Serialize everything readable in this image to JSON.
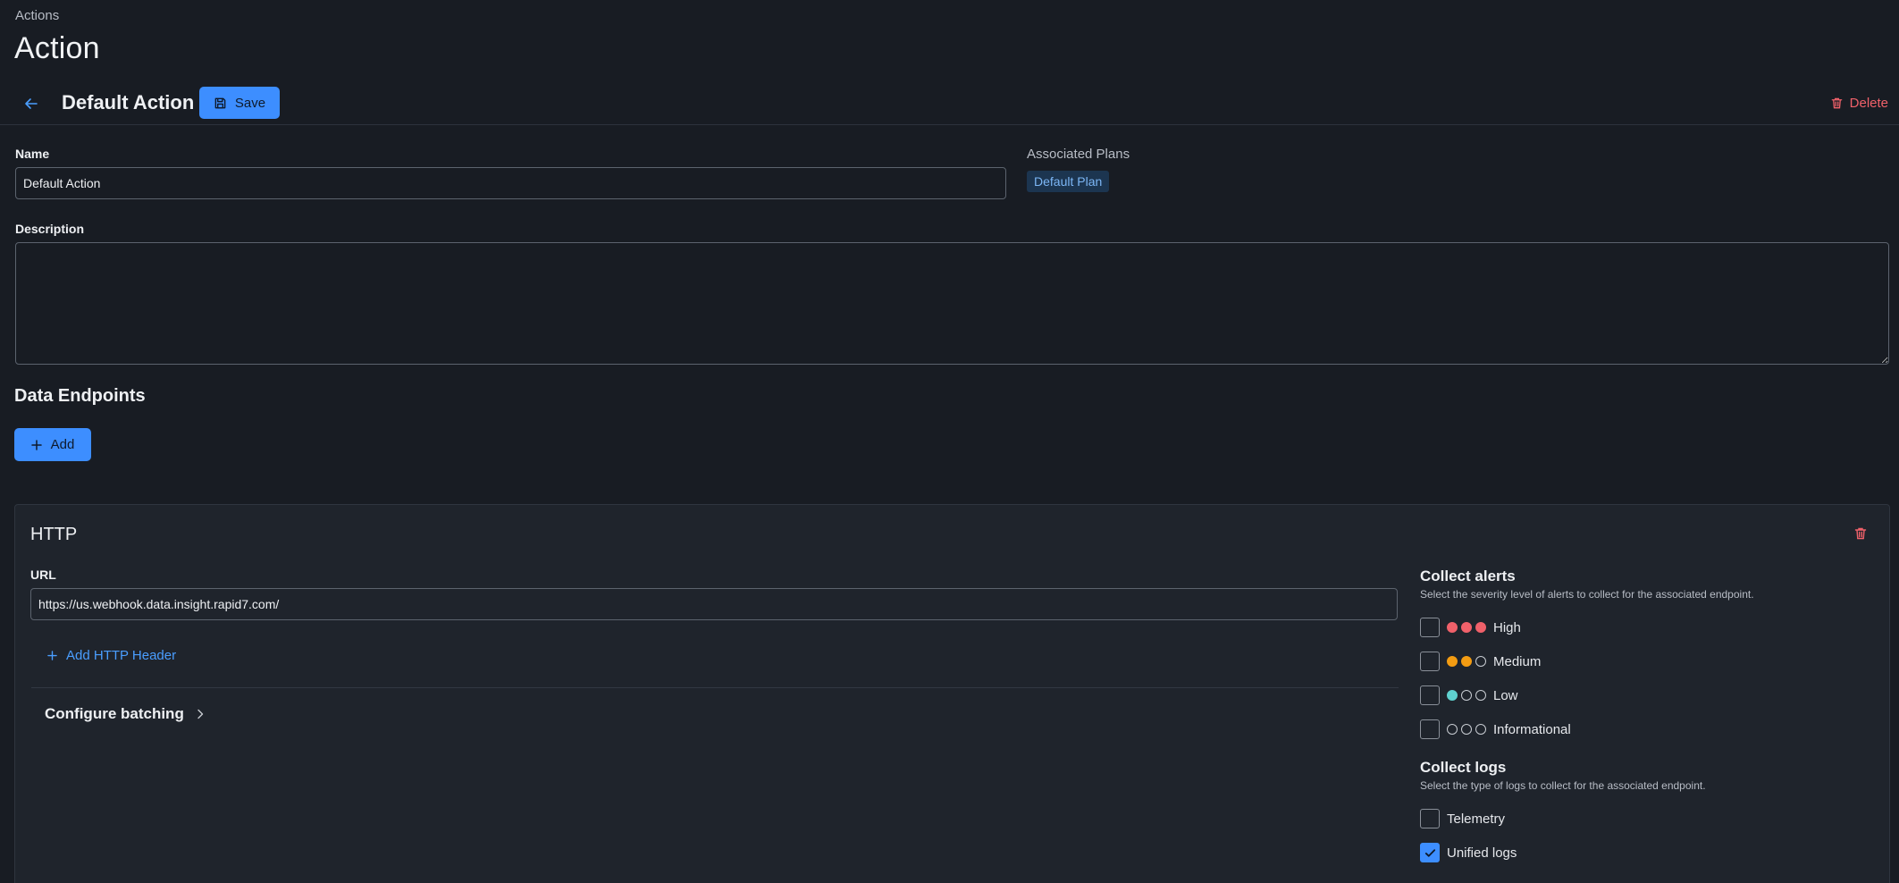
{
  "breadcrumb": "Actions",
  "page_title": "Action",
  "toolbar": {
    "action_name": "Default Action",
    "save_label": "Save",
    "delete_label": "Delete"
  },
  "form": {
    "name_label": "Name",
    "name_value": "Default Action",
    "description_label": "Description",
    "description_value": "",
    "associated_plans_label": "Associated Plans",
    "associated_plans": [
      "Default Plan"
    ]
  },
  "endpoints": {
    "title": "Data Endpoints",
    "add_label": "Add",
    "card": {
      "title": "HTTP",
      "url_label": "URL",
      "url_value": "https://us.webhook.data.insight.rapid7.com/",
      "add_header_label": "Add HTTP Header",
      "batching_label": "Configure batching",
      "alerts": {
        "title": "Collect alerts",
        "subtitle": "Select the severity level of alerts to collect for the associated endpoint.",
        "options": [
          {
            "label": "High",
            "checked": false,
            "filled": 3,
            "color": "#f0616a"
          },
          {
            "label": "Medium",
            "checked": false,
            "filled": 2,
            "color": "#f39c12"
          },
          {
            "label": "Low",
            "checked": false,
            "filled": 1,
            "color": "#5fd1cf"
          },
          {
            "label": "Informational",
            "checked": false,
            "filled": 0,
            "color": "#c8ccd2"
          }
        ]
      },
      "logs": {
        "title": "Collect logs",
        "subtitle": "Select the type of logs to collect for the associated endpoint.",
        "options": [
          {
            "label": "Telemetry",
            "checked": false
          },
          {
            "label": "Unified logs",
            "checked": true
          }
        ]
      }
    }
  },
  "colors": {
    "accent": "#3d8eff",
    "danger": "#f0616a",
    "background": "#181c23"
  }
}
